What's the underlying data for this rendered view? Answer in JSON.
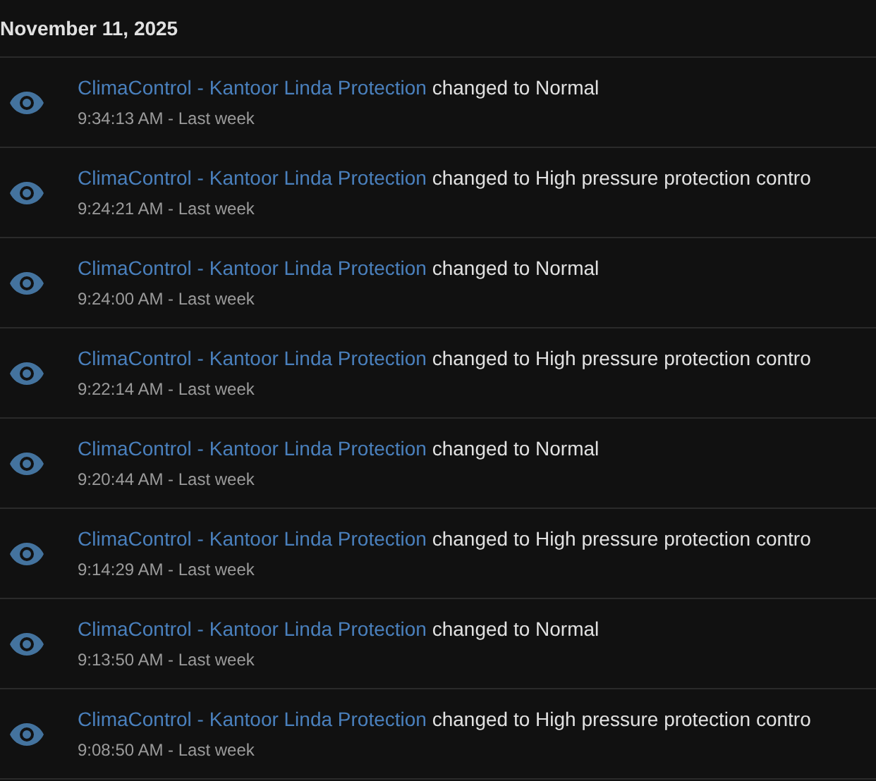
{
  "date_heading": "November 11, 2025",
  "events": [
    {
      "entity": "ClimaControl - Kantoor Linda Protection",
      "message": "changed to Normal",
      "time": "9:34:13 AM - Last week"
    },
    {
      "entity": "ClimaControl - Kantoor Linda Protection",
      "message": "changed to High pressure protection contro",
      "time": "9:24:21 AM - Last week"
    },
    {
      "entity": "ClimaControl - Kantoor Linda Protection",
      "message": "changed to Normal",
      "time": "9:24:00 AM - Last week"
    },
    {
      "entity": "ClimaControl - Kantoor Linda Protection",
      "message": "changed to High pressure protection contro",
      "time": "9:22:14 AM - Last week"
    },
    {
      "entity": "ClimaControl - Kantoor Linda Protection",
      "message": "changed to Normal",
      "time": "9:20:44 AM - Last week"
    },
    {
      "entity": "ClimaControl - Kantoor Linda Protection",
      "message": "changed to High pressure protection contro",
      "time": "9:14:29 AM - Last week"
    },
    {
      "entity": "ClimaControl - Kantoor Linda Protection",
      "message": "changed to Normal",
      "time": "9:13:50 AM - Last week"
    },
    {
      "entity": "ClimaControl - Kantoor Linda Protection",
      "message": "changed to High pressure protection contro",
      "time": "9:08:50 AM - Last week"
    }
  ]
}
